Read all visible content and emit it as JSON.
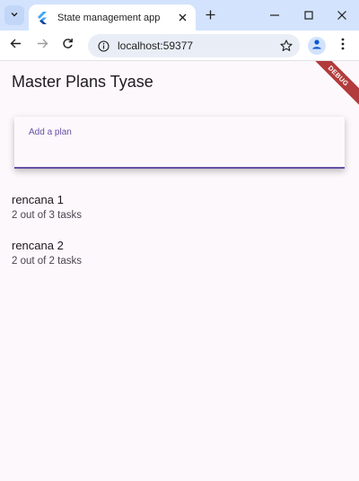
{
  "browser": {
    "tab_title": "State management app",
    "url": "localhost:59377"
  },
  "app": {
    "title": "Master Plans Tyase",
    "debug_banner": "DEBUG",
    "add_plan_label": "Add a plan",
    "accent_color": "#6750a4",
    "plans": [
      {
        "name": "rencana 1",
        "progress": "2 out of 3 tasks"
      },
      {
        "name": "rencana 2",
        "progress": "2 out of 2 tasks"
      }
    ]
  }
}
